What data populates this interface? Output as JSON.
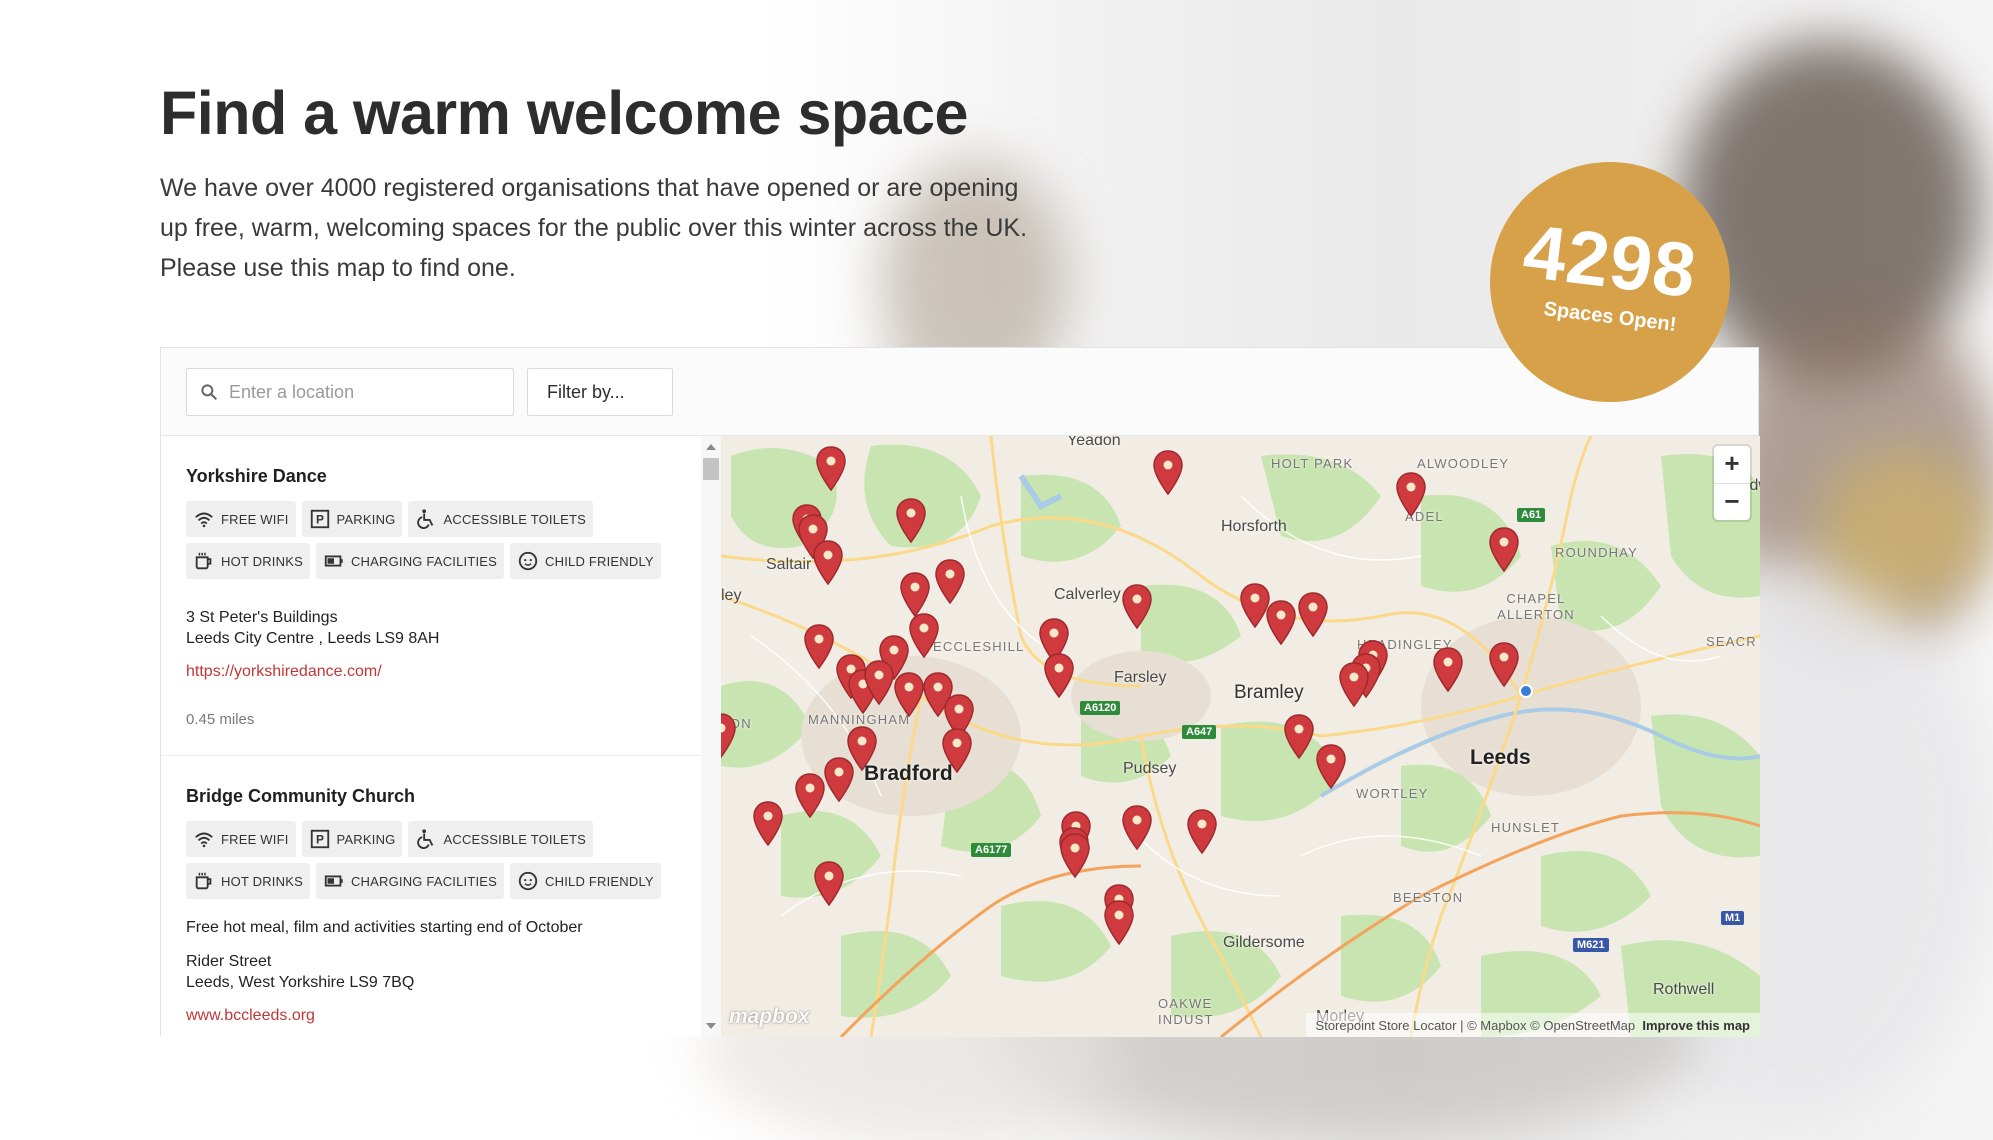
{
  "page": {
    "title": "Find a warm welcome space",
    "intro": "We have over 4000 registered organisations that have opened or are opening up free, warm, welcoming spaces for the public over this winter across the UK. Please use this map to find one."
  },
  "badge": {
    "count": "4298",
    "label": "Spaces Open!",
    "color": "#d6a148"
  },
  "search": {
    "placeholder": "Enter a location",
    "value": ""
  },
  "filter": {
    "label": "Filter by..."
  },
  "tag_labels": {
    "wifi": "FREE WIFI",
    "parking": "PARKING",
    "toilets": "ACCESSIBLE TOILETS",
    "drinks": "HOT DRINKS",
    "charging": "CHARGING FACILITIES",
    "child": "CHILD FRIENDLY"
  },
  "locations": [
    {
      "name": "Yorkshire Dance",
      "address_line1": "3 St Peter's Buildings",
      "address_line2": "Leeds City Centre , Leeds LS9 8AH",
      "url": "https://yorkshiredance.com/",
      "distance": "0.45 miles"
    },
    {
      "name": "Bridge Community Church",
      "description": "Free hot meal, film and activities starting end of October",
      "address_line1": "Rider Street",
      "address_line2": "Leeds, West Yorkshire LS9 7BQ",
      "url": "www.bccleeds.org"
    }
  ],
  "map": {
    "labels": {
      "yeadon": "Yeadon",
      "holt_park": "HOLT PARK",
      "alwoodley": "ALWOODLEY",
      "shadwell": "Shadw",
      "adel": "ADEL",
      "horsforth": "Horsforth",
      "roundhay": "ROUNDHAY",
      "saltaire": "Saltair",
      "ley": "ley",
      "calverley": "Calverley",
      "chapel_allerton": "CHAPEL ALLERTON",
      "eccleshill": "ECCLESHILL",
      "headingley": "HEADINGLEY",
      "seacroft": "SEACR",
      "farsley": "Farsley",
      "bramley": "Bramley",
      "ton": "TON",
      "manningham": "MANNINGHAM",
      "pudsey": "Pudsey",
      "leeds": "Leeds",
      "bradford": "Bradford",
      "wortley": "WORTLEY",
      "hunslet": "HUNSLET",
      "beeston": "BEESTON",
      "gildersome": "Gildersome",
      "rothwell": "Rothwell",
      "oakwell": "OAKWE INDUST",
      "morley": "Morley"
    },
    "road_signs": {
      "a61": "A61",
      "a6120": "A6120",
      "a647": "A647",
      "a6177": "A6177",
      "m1": "M1",
      "m621": "M621"
    },
    "logo": "mapbox",
    "attribution": {
      "storepoint": "Storepoint Store Locator",
      "mapbox": "| © Mapbox",
      "osm": "© OpenStreetMap",
      "improve": "Improve this map"
    },
    "zoom_in": "+",
    "zoom_out": "−",
    "pin_color": "#cf3a3f"
  }
}
